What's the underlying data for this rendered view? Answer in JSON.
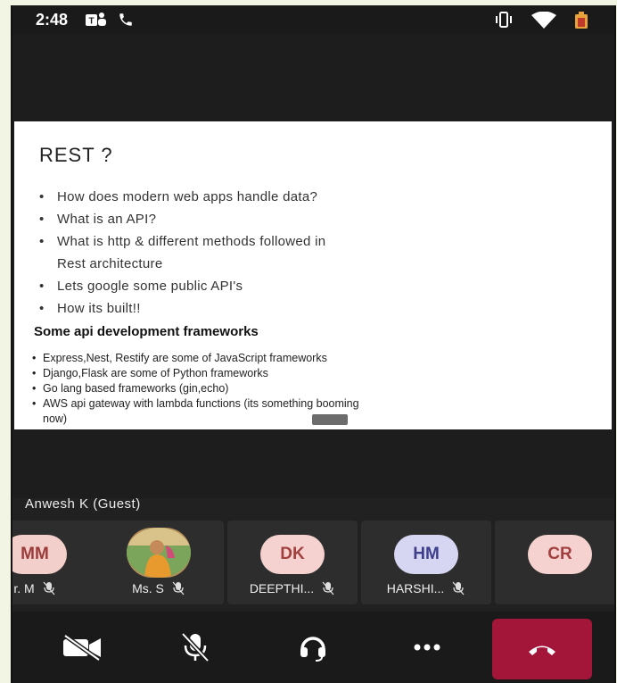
{
  "status_bar": {
    "time": "2:48",
    "left_icons": [
      "teams-icon",
      "phone-icon"
    ],
    "right_icons": [
      "vibrate-icon",
      "wifi-icon",
      "battery-icon"
    ]
  },
  "slide": {
    "title": "REST ?",
    "bullets": [
      {
        "text": "How does modern web apps handle data?",
        "cont": false
      },
      {
        "text": "What is an API?",
        "cont": false
      },
      {
        "text": "What is http & different methods followed in",
        "cont": false
      },
      {
        "text": "Rest architecture",
        "cont": true
      },
      {
        "text": "Lets google some public API's",
        "cont": false
      },
      {
        "text": "How its built!!",
        "cont": false
      }
    ],
    "subtitle": "Some api development frameworks",
    "small_bullets": [
      {
        "text": "Express,Nest, Restify are some of JavaScript frameworks",
        "cont": false
      },
      {
        "text": "Django,Flask are some of Python frameworks",
        "cont": false
      },
      {
        "text": "Go lang based frameworks (gin,echo)",
        "cont": false
      },
      {
        "text": "AWS api gateway with lambda functions (its something booming",
        "cont": false
      },
      {
        "text": "now)",
        "cont": true
      }
    ]
  },
  "speaker": {
    "name": "Anwesh K (Guest)"
  },
  "participants": [
    {
      "initials": "MM",
      "name": "r. M",
      "bg": "#f2cfcb",
      "fg": "#9b3a3a",
      "photo": false
    },
    {
      "initials": "",
      "name": "Ms. S",
      "bg": "#b58c5a",
      "fg": "#fff",
      "photo": true
    },
    {
      "initials": "DK",
      "name": "DEEPTHI...",
      "bg": "#f5d2cf",
      "fg": "#a23f3f",
      "photo": false
    },
    {
      "initials": "HM",
      "name": "HARSHI...",
      "bg": "#d6d6f2",
      "fg": "#3d3d8a",
      "photo": false
    },
    {
      "initials": "CR",
      "name": "",
      "bg": "#f5d2cf",
      "fg": "#a23f3f",
      "photo": false
    }
  ],
  "controls": {
    "items": [
      "camera-off-icon",
      "mic-off-icon",
      "headset-icon",
      "more-icon"
    ],
    "end_call_color": "#a3163a"
  }
}
